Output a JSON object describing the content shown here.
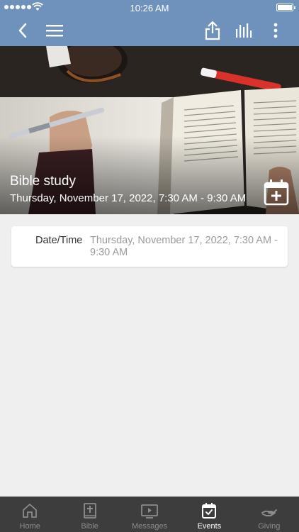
{
  "status_bar": {
    "time": "10:26 AM"
  },
  "event": {
    "title": "Bible study",
    "datetime": "Thursday, November 17, 2022, 7:30 AM - 9:30 AM"
  },
  "details": {
    "datetime_label": "Date/Time",
    "datetime_value": "Thursday, November 17, 2022, 7:30 AM - 9:30 AM"
  },
  "tabs": [
    {
      "label": "Home",
      "icon": "home-icon"
    },
    {
      "label": "Bible",
      "icon": "bible-icon"
    },
    {
      "label": "Messages",
      "icon": "messages-icon"
    },
    {
      "label": "Events",
      "icon": "events-icon",
      "active": true
    },
    {
      "label": "Giving",
      "icon": "giving-icon"
    }
  ],
  "colors": {
    "header": "#6f92bd",
    "background": "#efefef",
    "tabbar": "#3d3d3d",
    "tab_active": "#ffffff",
    "tab_inactive": "#8c8c8c"
  }
}
